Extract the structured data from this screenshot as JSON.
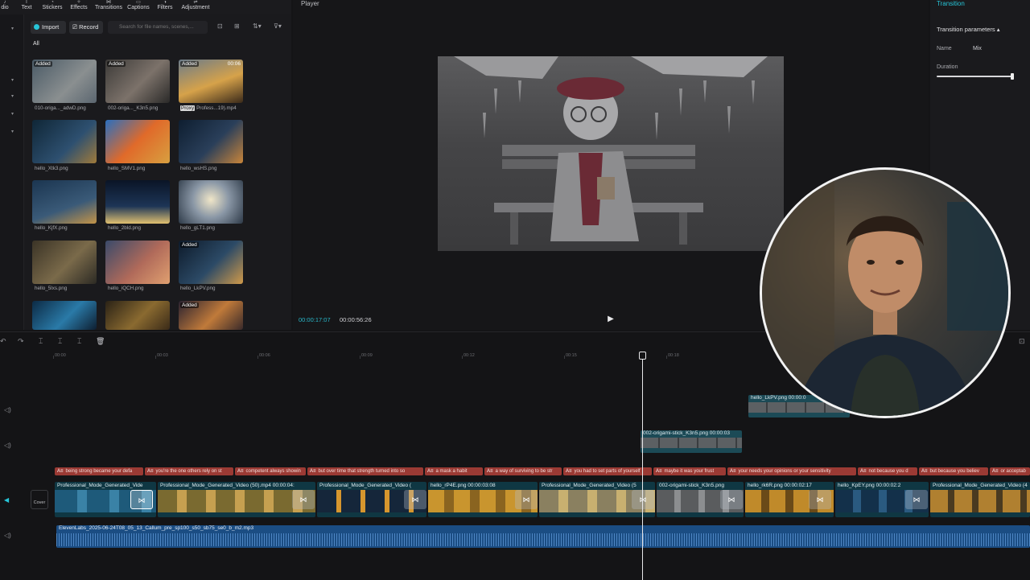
{
  "colors": {
    "accent": "#27c5d8",
    "caption_track": "#9b3a34",
    "audio_track": "#1b4d83",
    "video_track": "#0f3743"
  },
  "toolbar": {
    "items": [
      {
        "label": "dio",
        "icon": "music-icon"
      },
      {
        "label": "Text",
        "icon": "text-icon"
      },
      {
        "label": "Stickers",
        "icon": "sticker-icon"
      },
      {
        "label": "Effects",
        "icon": "effects-icon"
      },
      {
        "label": "Transitions",
        "icon": "transitions-icon"
      },
      {
        "label": "Captions",
        "icon": "captions-icon"
      },
      {
        "label": "Filters",
        "icon": "filters-icon"
      },
      {
        "label": "Adjustment",
        "icon": "adjustment-icon"
      }
    ]
  },
  "media": {
    "import_label": "Import",
    "record_label": "Record",
    "search_placeholder": "Search for file names, scenes,...",
    "all_tab": "All",
    "items": [
      {
        "name": "010-origa..._adwD.png",
        "added": "Added",
        "duration": "",
        "proxy": ""
      },
      {
        "name": "002-origa..._K3n5.png",
        "added": "Added",
        "duration": "",
        "proxy": ""
      },
      {
        "name": "Profess...19).mp4",
        "added": "Added",
        "duration": "00:06",
        "proxy": "Proxy"
      },
      {
        "name": "hello_Xtk3.png",
        "added": "",
        "duration": "",
        "proxy": ""
      },
      {
        "name": "hello_SMV1.png",
        "added": "",
        "duration": "",
        "proxy": ""
      },
      {
        "name": "hello_wsHS.png",
        "added": "",
        "duration": "",
        "proxy": ""
      },
      {
        "name": "hello_KjfX.png",
        "added": "",
        "duration": "",
        "proxy": ""
      },
      {
        "name": "hello_2bld.png",
        "added": "",
        "duration": "",
        "proxy": ""
      },
      {
        "name": "hello_gLT1.png",
        "added": "",
        "duration": "",
        "proxy": ""
      },
      {
        "name": "hello_5lxs.png",
        "added": "",
        "duration": "",
        "proxy": ""
      },
      {
        "name": "hello_iQCH.png",
        "added": "",
        "duration": "",
        "proxy": ""
      },
      {
        "name": "hello_LkPV.png",
        "added": "Added",
        "duration": "",
        "proxy": ""
      },
      {
        "name": "",
        "added": "",
        "duration": "",
        "proxy": ""
      },
      {
        "name": "",
        "added": "",
        "duration": "",
        "proxy": ""
      },
      {
        "name": "",
        "added": "Added",
        "duration": "",
        "proxy": ""
      }
    ]
  },
  "player": {
    "title": "Player",
    "current_time": "00:00:17:07",
    "total_time": "00:00:56:26"
  },
  "inspector": {
    "tab": "Transition",
    "section": "Transition parameters",
    "name_label": "Name",
    "name_value": "Mix",
    "duration_label": "Duration",
    "duration_level": 0.98
  },
  "timeline": {
    "ruler": [
      "00:00",
      "00:03",
      "00:06",
      "00:09",
      "00:12",
      "00:15",
      "00:18"
    ],
    "overlay_clip": "hello_LkPV.png 00:00:0",
    "image_clip": "002-origami-stick_K3n5.png 00:00:03",
    "captions": [
      "being strong became your defa",
      "you're the one others rely on st",
      "competent always showin",
      "but over time that strength turned into so",
      "a mask a habit",
      "a way of surviving to be str",
      "you had to set parts of yourself",
      "maybe it was your frust",
      "your needs your opinions or your sensitivity",
      "not because you d",
      "but because you believ",
      "or acceptab"
    ],
    "caption_prefix": "A≡",
    "cover_label": "Cover",
    "video_clips": [
      "Professional_Mode_Generated_Vide",
      "Professional_Mode_Generated_Video (50).mp4  00:00:04:",
      "Professional_Mode_Generated_Video (",
      "hello_rP4E.png  00:00:03:08",
      "Professional_Mode_Generated_Video (5",
      "002-origami-stick_K3n5.png",
      "hello_rk6R.png  00:00:02:17",
      "hello_KpEY.png  00:00:02:2",
      "Professional_Mode_Generated_Video (4"
    ],
    "audio_clip": "ElevenLabs_2025-06-24T08_05_13_Callum_pre_sp100_s50_sb75_se0_b_m2.mp3"
  }
}
